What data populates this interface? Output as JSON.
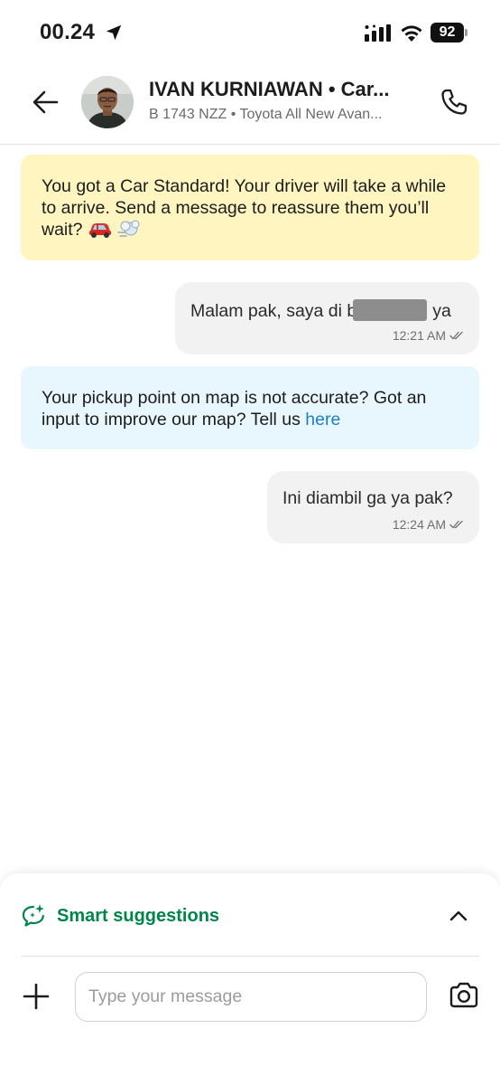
{
  "status_bar": {
    "time": "00.24",
    "battery": "92"
  },
  "header": {
    "driver_name": "IVAN KURNIAWAN • Car...",
    "vehicle_info": "B 1743 NZZ • Toyota All New Avan..."
  },
  "chat": {
    "notice_car": "You got a Car Standard! Your driver will take a while to arrive. Send a message to reassure them you’ll wait?",
    "message_1": {
      "text_before": "Malam pak, saya di b",
      "text_after": "ya",
      "time": "12:21 AM"
    },
    "notice_map_text": "Your pickup point on map is not accurate? Got an input to improve our map? Tell us",
    "notice_map_link": "here",
    "message_2": {
      "text": "Ini diambil ga ya pak?",
      "time": "12:24 AM"
    }
  },
  "bottom": {
    "smart_suggestions_label": "Smart suggestions",
    "input_placeholder": "Type your message"
  },
  "colors": {
    "brand_green": "#00864a",
    "link_blue": "#1f7fc6",
    "notice_yellow": "#fff5c0",
    "notice_blue": "#e8f6fe",
    "bubble_gray": "#f2f2f2"
  },
  "icons": [
    "location-arrow-icon",
    "cellular-signal-icon",
    "wifi-icon",
    "battery-icon",
    "back-arrow-icon",
    "phone-icon",
    "car-emoji-icon",
    "dash-puff-emoji-icon",
    "double-check-icon",
    "sparkle-chat-icon",
    "chevron-up-icon",
    "plus-icon",
    "camera-icon"
  ]
}
